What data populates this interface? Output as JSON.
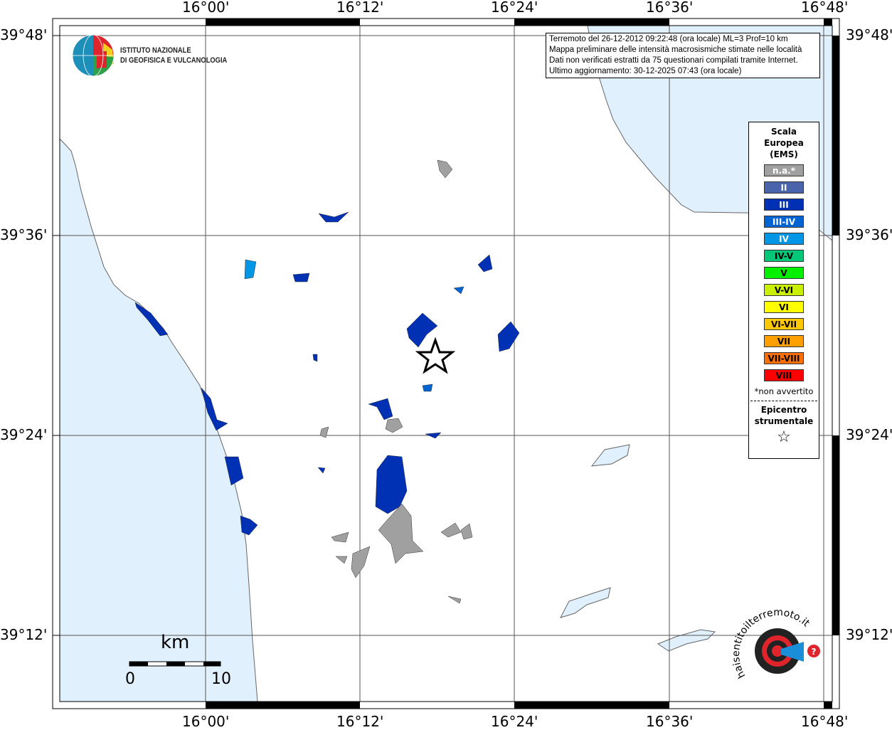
{
  "info": {
    "lines": [
      "Terremoto del 26-12-2012 09:22:48 (ora locale) ML=3 Prof=10 km",
      "Mappa preliminare delle intensità macrosismiche stimate nelle località",
      "Dati non verificati estratti da 75 questionari compilati tramite Internet.",
      "Ultimo aggiornamento: 30-12-2025 07:43 (ora locale)"
    ]
  },
  "axes": {
    "lon_ticks": [
      "16°00'",
      "16°12'",
      "16°24'",
      "16°36'",
      "16°48'"
    ],
    "lat_ticks": [
      "39°48'",
      "39°36'",
      "39°24'",
      "39°12'"
    ]
  },
  "logo": {
    "institute": [
      "ISTITUTO NAZIONALE",
      "DI GEOFISICA E VULCANOLOGIA"
    ],
    "site": "www.haisentitoilterremoto.it"
  },
  "legend": {
    "title": [
      "Scala",
      "Europea",
      "(EMS)"
    ],
    "items": [
      {
        "label": "n.a.*",
        "color": "#a0a0a0",
        "text": "#fff"
      },
      {
        "label": "II",
        "color": "#4a64ac",
        "text": "#fff"
      },
      {
        "label": "III",
        "color": "#0030b4",
        "text": "#fff"
      },
      {
        "label": "III-IV",
        "color": "#0064d2",
        "text": "#fff"
      },
      {
        "label": "IV",
        "color": "#0096e6",
        "text": "#fff"
      },
      {
        "label": "IV-V",
        "color": "#00c878",
        "text": "#000"
      },
      {
        "label": "V",
        "color": "#00f000",
        "text": "#000"
      },
      {
        "label": "V-VI",
        "color": "#c8f000",
        "text": "#000"
      },
      {
        "label": "VI",
        "color": "#ffff00",
        "text": "#000"
      },
      {
        "label": "VI-VII",
        "color": "#ffc800",
        "text": "#000"
      },
      {
        "label": "VII",
        "color": "#ffa000",
        "text": "#000"
      },
      {
        "label": "VII-VIII",
        "color": "#ff6e00",
        "text": "#000"
      },
      {
        "label": "VIII",
        "color": "#ff0000",
        "text": "#000"
      }
    ],
    "note": "*non avvertito",
    "epicenter": [
      "Epicentro",
      "strumentale"
    ],
    "epicenter_symbol": "☆"
  },
  "scale_bar": {
    "unit": "km",
    "min": "0",
    "max": "10"
  },
  "colors": {
    "sea": "#e0f0fc",
    "land": "#ffffff",
    "grid": "#555555"
  }
}
